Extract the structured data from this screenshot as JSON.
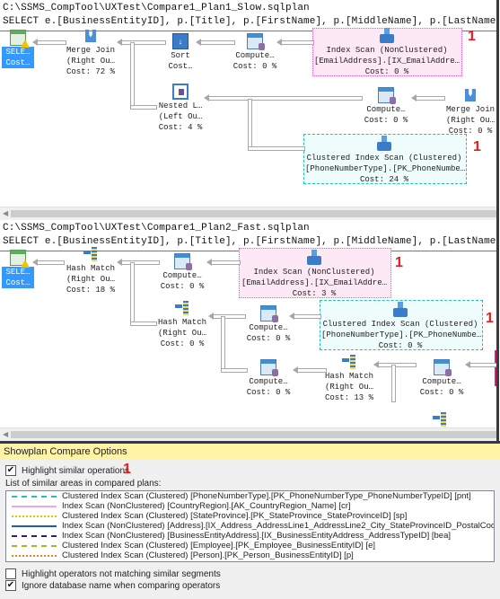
{
  "plan1": {
    "file_path": "C:\\SSMS_CompTool\\UXTest\\Compare1_Plan1_Slow.sqlplan",
    "query": "SELECT e.[BusinessEntityID], p.[Title], p.[FirstName], p.[MiddleName], p.[LastName]",
    "nodes": {
      "select": {
        "line1": "SELE…",
        "line2": "Cost…"
      },
      "merge_join_1": {
        "line1": "Merge Join",
        "line2": "(Right Ou…",
        "line3": "Cost: 72 %"
      },
      "sort": {
        "line1": "Sort",
        "line2": "Cost…"
      },
      "compute_1": {
        "line1": "Compute…",
        "line2": "Cost: 0 %"
      },
      "index_scan": {
        "line1": "Index Scan (NonClustered)",
        "line2": "[EmailAddress].[IX_EmailAddre…",
        "line3": "Cost: 0 %"
      },
      "nested_loops": {
        "line1": "Nested L…",
        "line2": "(Left Ou…",
        "line3": "Cost: 4 %"
      },
      "compute_2": {
        "line1": "Compute…",
        "line2": "Cost: 0 %"
      },
      "merge_join_2": {
        "line1": "Merge Join",
        "line2": "(Right Ou…",
        "line3": "Cost: 0 %"
      },
      "clustered_scan": {
        "line1": "Clustered Index Scan (Clustered)",
        "line2": "[PhoneNumberType].[PK_PhoneNumbe…",
        "line3": "Cost: 24 %"
      }
    },
    "markers": [
      "1",
      "1"
    ]
  },
  "plan2": {
    "file_path": "C:\\SSMS_CompTool\\UXTest\\Compare1_Plan2_Fast.sqlplan",
    "query": "SELECT e.[BusinessEntityID], p.[Title], p.[FirstName], p.[MiddleName], p.[LastName]",
    "nodes": {
      "select": {
        "line1": "SELE…",
        "line2": "Cost…"
      },
      "hash_match_1": {
        "line1": "Hash Match",
        "line2": "(Right Ou…",
        "line3": "Cost: 18 %"
      },
      "compute_1": {
        "line1": "Compute…",
        "line2": "Cost: 0 %"
      },
      "index_scan": {
        "line1": "Index Scan (NonClustered)",
        "line2": "[EmailAddress].[IX_EmailAddre…",
        "line3": "Cost: 3 %"
      },
      "hash_match_2": {
        "line1": "Hash Match",
        "line2": "(Right Ou…",
        "line3": "Cost: 0 %"
      },
      "compute_2": {
        "line1": "Compute…",
        "line2": "Cost: 0 %"
      },
      "clustered_scan": {
        "line1": "Clustered Index Scan (Clustered)",
        "line2": "[PhoneNumberType].[PK_PhoneNumbe…",
        "line3": "Cost: 0 %"
      },
      "compute_3": {
        "line1": "Compute…",
        "line2": "Cost: 0 %"
      },
      "hash_match_3": {
        "line1": "Hash Match",
        "line2": "(Right Ou…",
        "line3": "Cost: 13 %"
      },
      "compute_4": {
        "line1": "Compute…",
        "line2": "Cost: 0 %"
      }
    },
    "markers": [
      "1",
      "1"
    ]
  },
  "options": {
    "title": "Showplan Compare Options",
    "highlight_similar": {
      "label": "Highlight similar operations",
      "checked": true
    },
    "marker": "1",
    "list_label": "List of similar areas in compared plans:",
    "areas": [
      {
        "label": "Clustered Index Scan (Clustered) [PhoneNumberType].[PK_PhoneNumberType_PhoneNumberTypeID] [pnt]",
        "color": "#22c0b8",
        "style": "dashed"
      },
      {
        "label": "Index Scan (NonClustered) [CountryRegion].[AK_CountryRegion_Name] [cr]",
        "color": "#f4a6d8",
        "style": "solid"
      },
      {
        "label": "Clustered Index Scan (Clustered) [StateProvince].[PK_StateProvince_StateProvinceID] [sp]",
        "color": "#e8c000",
        "style": "dotted"
      },
      {
        "label": "Index Scan (NonClustered) [Address].[IX_Address_AddressLine1_AddressLine2_City_StateProvinceID_PostalCode] [a]",
        "color": "#1a5fc0",
        "style": "solid"
      },
      {
        "label": "Index Scan (NonClustered) [BusinessEntityAddress].[IX_BusinessEntityAddress_AddressTypeID] [bea]",
        "color": "#3a1a70",
        "style": "dashed"
      },
      {
        "label": "Clustered Index Scan (Clustered) [Employee].[PK_Employee_BusinessEntityID] [e]",
        "color": "#9ac020",
        "style": "dashed"
      },
      {
        "label": "Clustered Index Scan (Clustered) [Person].[PK_Person_BusinessEntityID] [p]",
        "color": "#f08020",
        "style": "dotted"
      }
    ],
    "highlight_not_matching": {
      "label": "Highlight operators not matching similar segments",
      "checked": false
    },
    "ignore_db_name": {
      "label": "Ignore database name when comparing operators",
      "checked": true
    }
  }
}
